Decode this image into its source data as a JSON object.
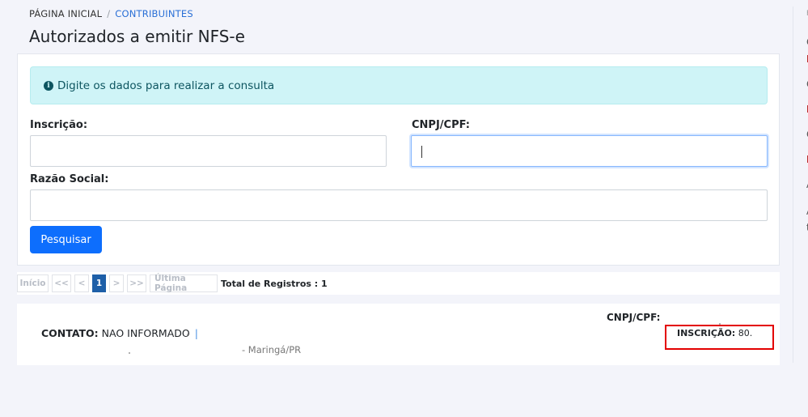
{
  "breadcrumb": {
    "home": "PÁGINA INICIAL",
    "separator": "/",
    "current": "CONTRIBUINTES"
  },
  "page_title": "Autorizados a emitir NFS-e",
  "alert": {
    "icon": "info-icon",
    "text": "Digite os dados para realizar a consulta"
  },
  "form": {
    "inscricao": {
      "label": "Inscrição:",
      "value": ""
    },
    "cnpj": {
      "label": "CNPJ/CPF:",
      "value": ""
    },
    "razao": {
      "label": "Razão Social:",
      "value": ""
    },
    "submit_label": "Pesquisar"
  },
  "pagination": {
    "first": "Início",
    "prev_prev": "<<",
    "prev": "<",
    "page": "1",
    "next": ">",
    "next_next": ">>",
    "last": "Última Página",
    "total": "Total de Registros : 1"
  },
  "result": {
    "cnpj_label": "CNPJ/CPF:",
    "contato_label": "CONTATO:",
    "contato_value": "NAO INFORMADO",
    "separator": "|",
    "city": "- Maringá/PR",
    "inscricao_label": "INSCRIÇÃO:",
    "inscricao_value": "80."
  },
  "colors": {
    "primary": "#0d6efd",
    "alert_bg": "#cff4f7",
    "highlight": "#e30000",
    "active_page": "#1e5fa8"
  },
  "right_column": {
    "glyphs": [
      "F",
      "C",
      "E",
      "C",
      "E",
      "C",
      "E",
      "A",
      "A",
      "t"
    ]
  }
}
